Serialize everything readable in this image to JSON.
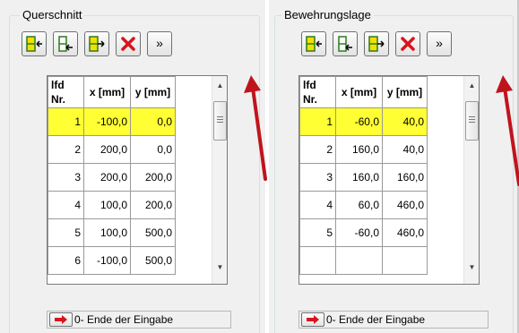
{
  "colors": {
    "selected_row": "#ffff33",
    "arrow_red": "#c0141c",
    "icon_yellow": "#f2e000",
    "icon_green": "#2c7a1c"
  },
  "left": {
    "title": "Querschnitt",
    "toolbar": {
      "insert_row_icon": "insert-row-icon",
      "append_row_icon": "append-row-icon",
      "insert_after_icon": "insert-after-icon",
      "delete_icon": "delete-icon",
      "more_label": "»"
    },
    "headers": {
      "nr": "lfd Nr.",
      "x": "x [mm]",
      "y": "y [mm]"
    },
    "rows": [
      {
        "nr": "1",
        "x": "-100,0",
        "y": "0,0"
      },
      {
        "nr": "2",
        "x": "200,0",
        "y": "0,0"
      },
      {
        "nr": "3",
        "x": "200,0",
        "y": "200,0"
      },
      {
        "nr": "4",
        "x": "100,0",
        "y": "200,0"
      },
      {
        "nr": "5",
        "x": "100,0",
        "y": "500,0"
      },
      {
        "nr": "6",
        "x": "-100,0",
        "y": "500,0"
      }
    ],
    "status_text": "0- Ende der Eingabe"
  },
  "right": {
    "title": "Bewehrungslage",
    "toolbar": {
      "insert_row_icon": "insert-row-icon",
      "append_row_icon": "append-row-icon",
      "insert_after_icon": "insert-after-icon",
      "delete_icon": "delete-icon",
      "more_label": "»"
    },
    "headers": {
      "nr": "lfd Nr.",
      "x": "x [mm]",
      "y": "y [mm]"
    },
    "rows": [
      {
        "nr": "1",
        "x": "-60,0",
        "y": "40,0"
      },
      {
        "nr": "2",
        "x": "160,0",
        "y": "40,0"
      },
      {
        "nr": "3",
        "x": "160,0",
        "y": "160,0"
      },
      {
        "nr": "4",
        "x": "60,0",
        "y": "460,0"
      },
      {
        "nr": "5",
        "x": "-60,0",
        "y": "460,0"
      },
      {
        "nr": "",
        "x": "",
        "y": ""
      }
    ],
    "status_text": "0- Ende der Eingabe"
  }
}
